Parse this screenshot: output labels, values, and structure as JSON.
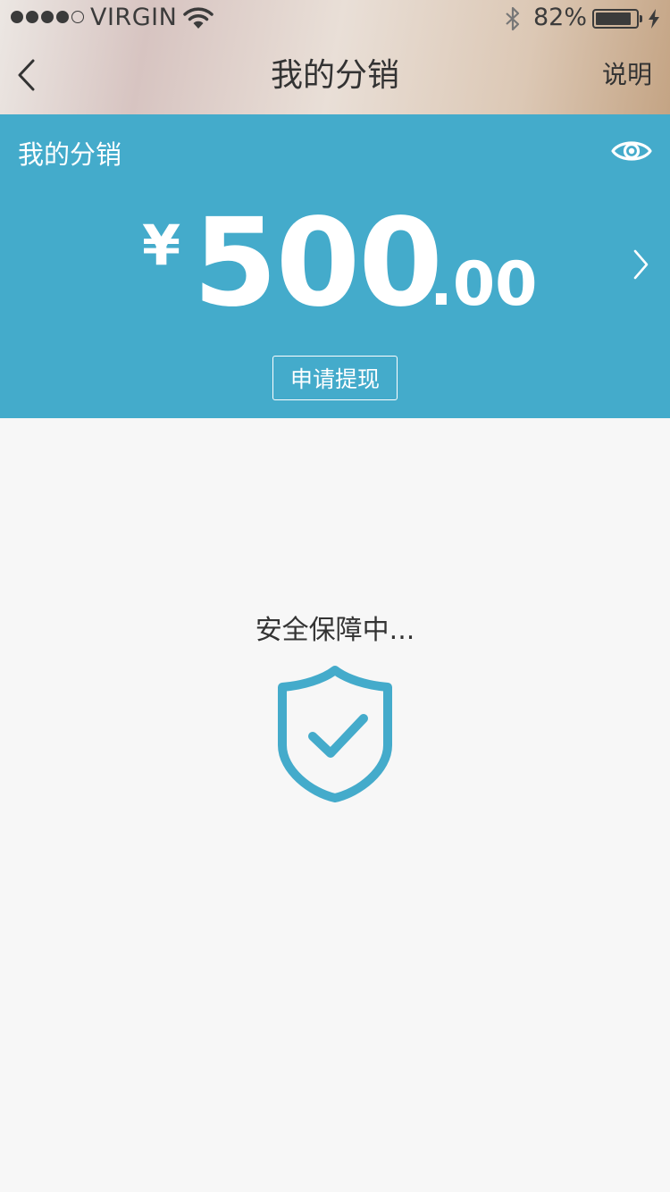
{
  "status_bar": {
    "carrier": "VIRGIN",
    "battery_percent": "82%",
    "battery_level": 0.82,
    "signal_bars_filled": 4,
    "signal_bars_total": 5,
    "icons": [
      "signal-dots-icon",
      "wifi-icon",
      "bluetooth-icon",
      "battery-icon",
      "charging-bolt-icon"
    ]
  },
  "nav": {
    "back_icon": "chevron-left-icon",
    "title": "我的分销",
    "help_label": "说明"
  },
  "card": {
    "title": "我的分销",
    "toggle_icon": "eye-icon",
    "currency_symbol": "¥",
    "amount_integer": "500",
    "amount_decimal": ".00",
    "detail_icon": "chevron-right-icon",
    "withdraw_label": "申请提现"
  },
  "security": {
    "text": "安全保障中...",
    "icon": "shield-check-icon"
  },
  "colors": {
    "accent": "#44abcb",
    "background": "#f7f7f7",
    "text": "#333333"
  }
}
